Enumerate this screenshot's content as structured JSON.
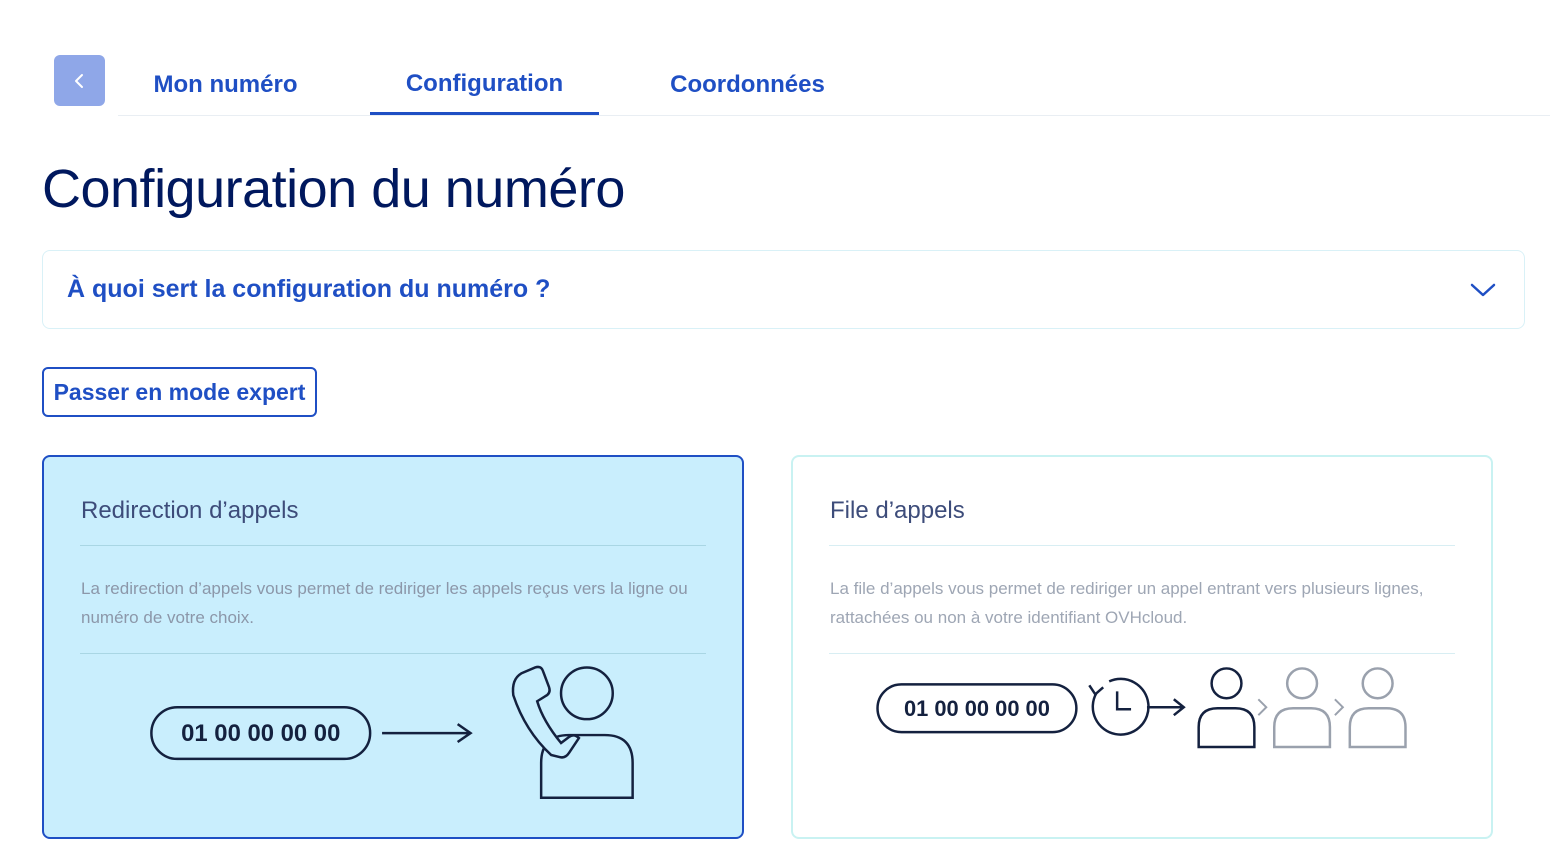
{
  "nav": {
    "back_icon": "chevron-left-icon",
    "tabs": [
      {
        "label": "Mon numéro",
        "active": false
      },
      {
        "label": "Configuration",
        "active": true
      },
      {
        "label": "Coordonnées",
        "active": false
      }
    ]
  },
  "page": {
    "title": "Configuration du numéro"
  },
  "faq": {
    "question": "À quoi sert la configuration du numéro ?",
    "expand_icon": "chevron-down-icon"
  },
  "actions": {
    "expert_mode_label": "Passer en mode expert"
  },
  "cards": [
    {
      "title": "Redirection d’appels",
      "description": "La redirection d’appels vous permet de rediriger les appels reçus vers la ligne ou numéro de votre choix.",
      "number": "01 00 00 00 00",
      "selected": true
    },
    {
      "title": "File d’appels",
      "description": "La file d’appels vous permet de rediriger un appel entrant vers plusieurs lignes, rattachées ou non à votre identifiant OVHcloud.",
      "number": "01 00 00 00 00",
      "selected": false
    }
  ],
  "colors": {
    "primary": "#1f4fc4",
    "title": "#00185e",
    "selected_card_bg": "#c9eefd",
    "back_button_bg": "#8fa7e8"
  }
}
